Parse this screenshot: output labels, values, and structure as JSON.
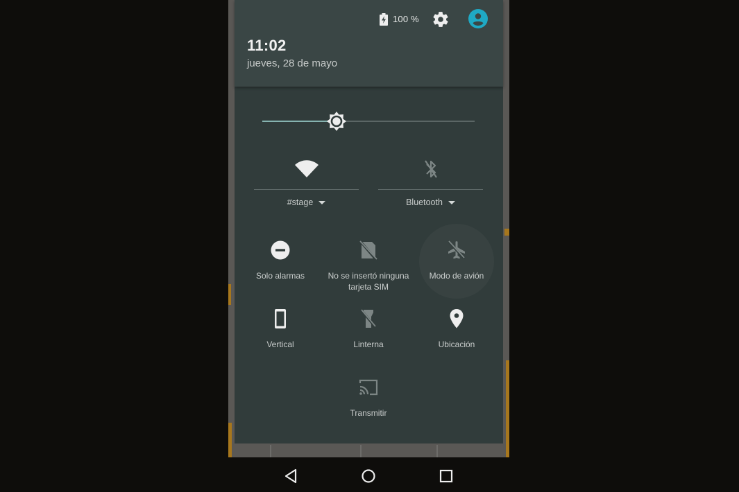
{
  "status_header": {
    "battery_icon": "battery-charging-icon",
    "battery_label": "100 %",
    "settings_icon": "gear-icon",
    "avatar_icon": "account-circle-icon",
    "avatar_color": "#1fa9c4",
    "time": "11:02",
    "date": "jueves, 28 de mayo"
  },
  "brightness": {
    "icon": "brightness-icon",
    "level": 0.35,
    "fill_color": "#86b3b0"
  },
  "big_tiles": [
    {
      "id": "wifi",
      "icon": "wifi-icon",
      "label": "#stage",
      "active": true
    },
    {
      "id": "bluetooth",
      "icon": "bluetooth-disabled-icon",
      "label": "Bluetooth",
      "active": false
    }
  ],
  "tiles": [
    {
      "id": "dnd",
      "icon": "do-not-disturb-icon",
      "label": "Solo alarmas",
      "active": true
    },
    {
      "id": "sim",
      "icon": "no-sim-icon",
      "label": "No se insertó ninguna tarjeta SIM",
      "active": false
    },
    {
      "id": "airplane",
      "icon": "airplane-off-icon",
      "label": "Modo de avión",
      "active": false
    },
    {
      "id": "rotation",
      "icon": "portrait-phone-icon",
      "label": "Vertical",
      "active": true
    },
    {
      "id": "flashlight",
      "icon": "flashlight-off-icon",
      "label": "Linterna",
      "active": false
    },
    {
      "id": "location",
      "icon": "location-pin-icon",
      "label": "Ubicación",
      "active": true
    },
    {
      "id": "cast",
      "icon": "cast-icon",
      "label": "Transmitir",
      "active": false
    }
  ],
  "nav_bar": {
    "back": "back-triangle-icon",
    "home": "home-circle-icon",
    "recents": "recents-square-icon"
  },
  "colors": {
    "header_bg": "#3a4645",
    "panel_bg": "#313c3b",
    "icon_active": "#eeeeee",
    "icon_inactive": "#7d8685"
  }
}
